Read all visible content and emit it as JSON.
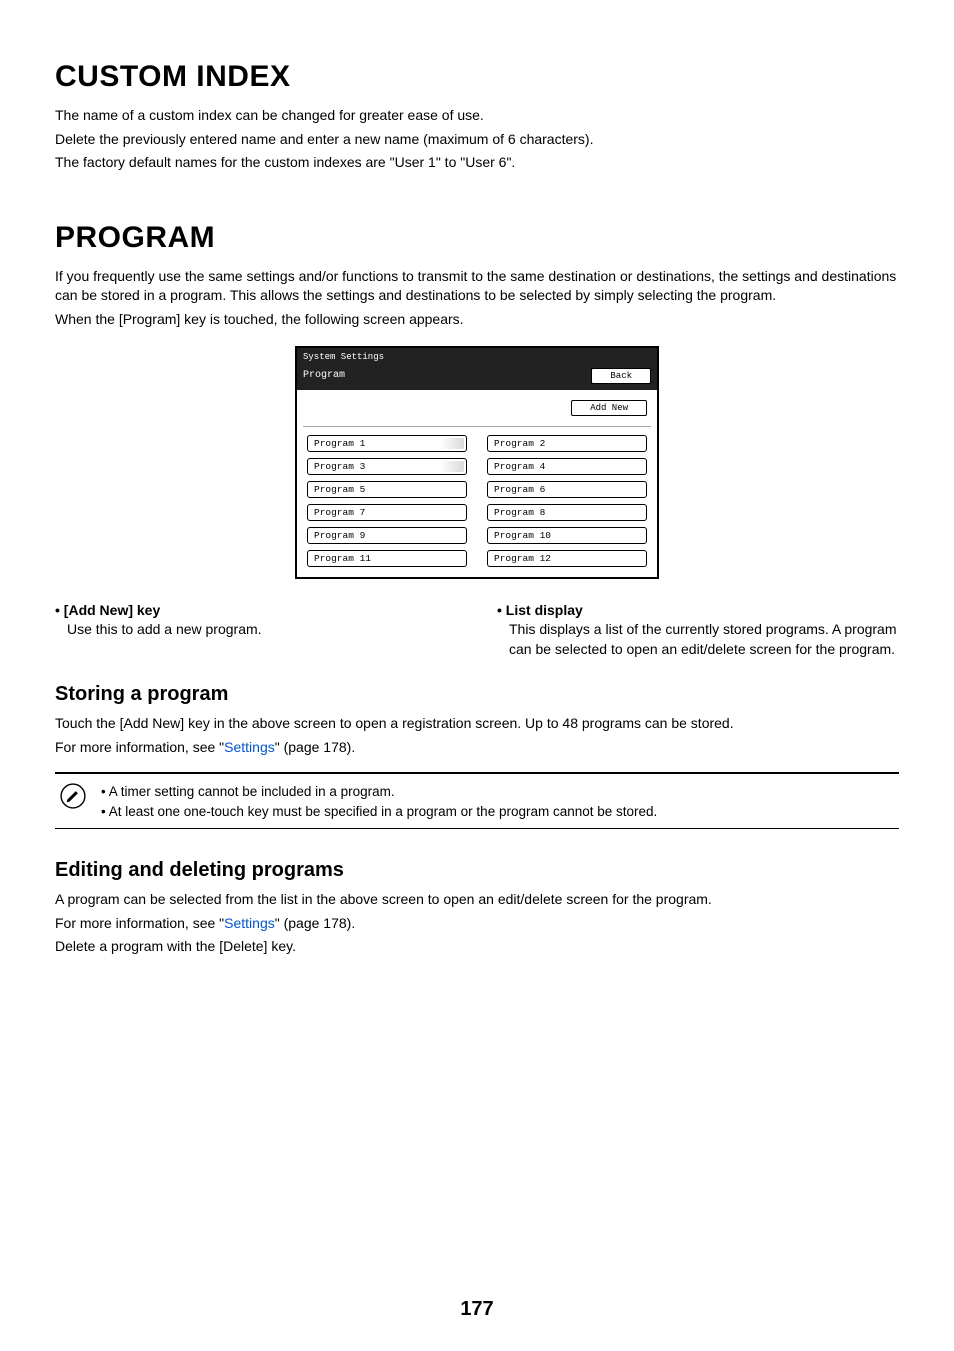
{
  "section_custom": {
    "title": "CUSTOM INDEX",
    "p1": "The name of a custom index can be changed for greater ease of use.",
    "p2": "Delete the previously entered name and enter a new name (maximum of 6 characters).",
    "p3": "The factory default names for the custom indexes are \"User 1\" to \"User 6\"."
  },
  "section_program": {
    "title": "PROGRAM",
    "intro1": "If you frequently use the same settings and/or functions to transmit to the same destination or destinations, the settings and destinations can be stored in a program. This allows the settings and destinations to be selected by simply selecting the program.",
    "intro2": "When the [Program] key is touched, the following screen appears."
  },
  "ui": {
    "header": "System Settings",
    "sub_label": "Program",
    "back_label": "Back",
    "add_new_label": "Add New",
    "programs": [
      "Program 1",
      "Program 2",
      "Program 3",
      "Program 4",
      "Program 5",
      "Program 6",
      "Program 7",
      "Program 8",
      "Program 9",
      "Program 10",
      "Program 11",
      "Program 12"
    ]
  },
  "bullets": {
    "left_title": "• [Add New] key",
    "left_body": "Use this to add a new program.",
    "right_title": "• List display",
    "right_body": "This displays a list of the currently stored programs. A program can be selected to open an edit/delete screen for the program."
  },
  "storing": {
    "title": "Storing a program",
    "p1": "Touch the [Add New] key in the above screen to open a registration screen. Up to 48 programs can be stored.",
    "p2_pre": "For more information, see \"",
    "p2_link": "Settings",
    "p2_post": "\" (page 178)."
  },
  "note": {
    "line1": "• A timer setting cannot be included in a program.",
    "line2": "• At least one one-touch key must be specified in a program or the program cannot be stored."
  },
  "editing": {
    "title": "Editing and deleting programs",
    "p1": "A program can be selected from the list in the above screen to open an edit/delete screen for the program.",
    "p2_pre": "For more information, see \"",
    "p2_link": "Settings",
    "p2_post": "\" (page 178).",
    "p3": "Delete a program with the [Delete] key."
  },
  "page_number": "177"
}
